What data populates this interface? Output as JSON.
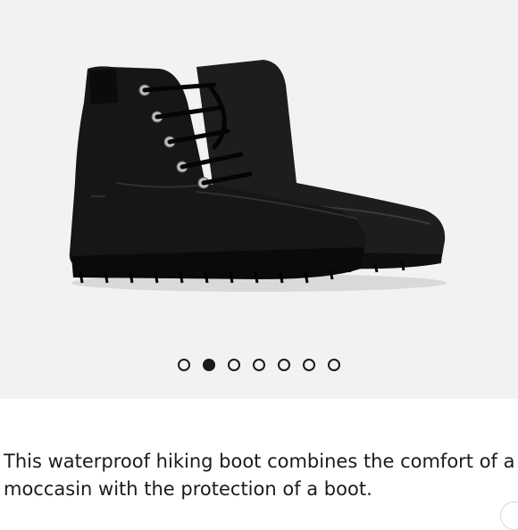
{
  "gallery": {
    "image_alt": "black leather lace-up boots",
    "total_slides": 7,
    "active_slide": 2
  },
  "description": {
    "line1": "This waterproof hiking boot combines the comfort of a",
    "line2": "moccasin with the protection of a boot."
  },
  "colors": {
    "gallery_background": "#f2f2f2",
    "boot": "#141414",
    "text": "#1b1b1b"
  }
}
